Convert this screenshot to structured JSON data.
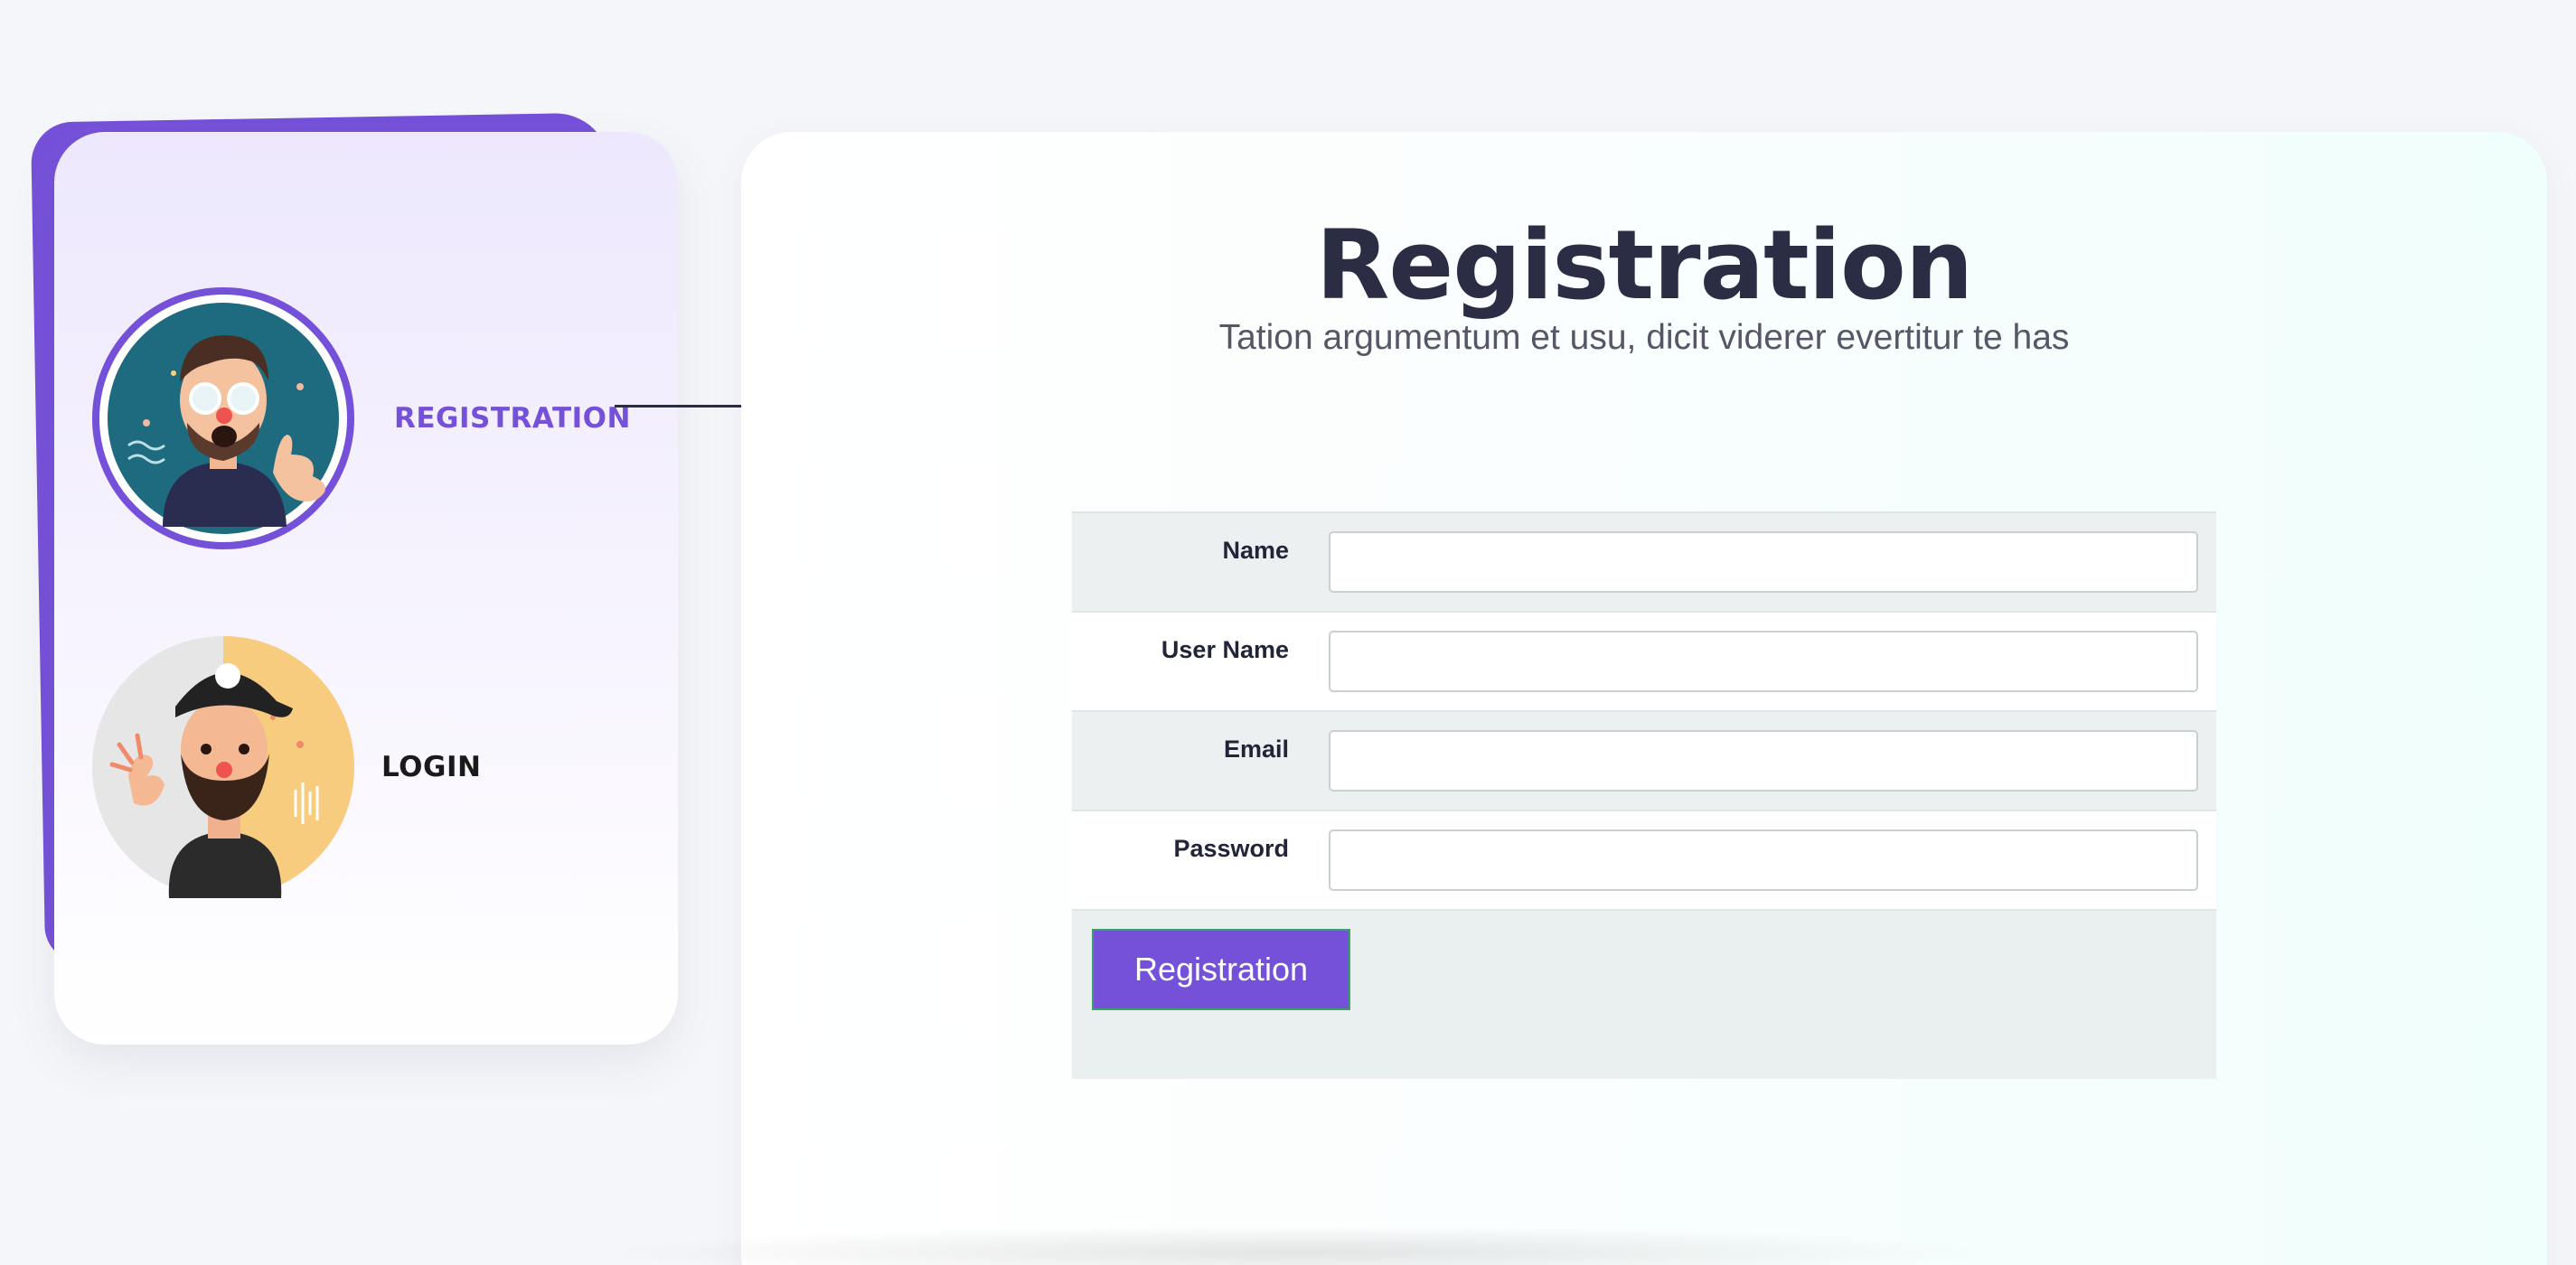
{
  "nav": {
    "items": [
      {
        "label": "REGISTRATION",
        "active": true,
        "avatar": "avatar-glasses-man-icon"
      },
      {
        "label": "LOGIN",
        "active": false,
        "avatar": "avatar-bearded-man-icon"
      }
    ]
  },
  "page": {
    "title": "Registration",
    "subtitle": "Tation argumentum et usu, dicit viderer evertitur te has"
  },
  "form": {
    "fields": [
      {
        "label": "Name",
        "value": "",
        "placeholder": ""
      },
      {
        "label": "User Name",
        "value": "",
        "placeholder": ""
      },
      {
        "label": "Email",
        "value": "",
        "placeholder": ""
      },
      {
        "label": "Password",
        "value": "",
        "placeholder": ""
      }
    ],
    "submit_label": "Registration"
  },
  "colors": {
    "accent": "#7551d9",
    "heading": "#2b2d45",
    "submit_border": "#3ca069"
  }
}
